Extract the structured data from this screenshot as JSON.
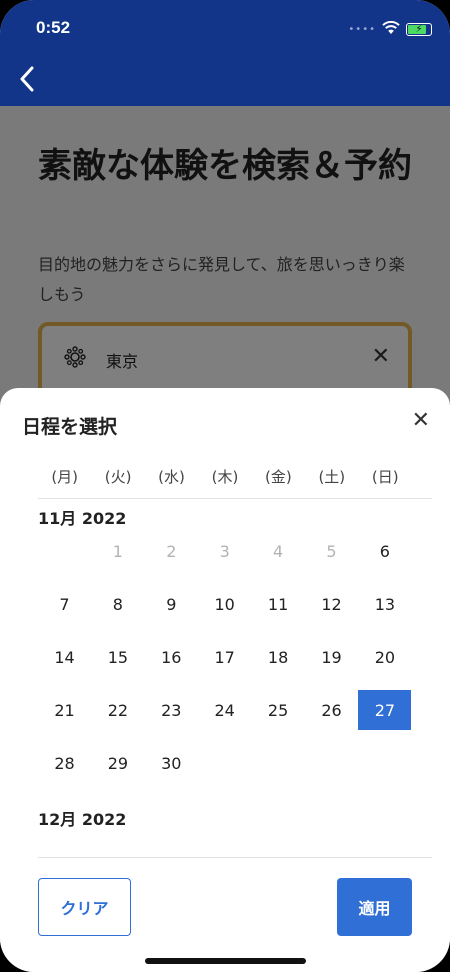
{
  "status_bar": {
    "time": "0:52"
  },
  "hero": {
    "title": "素敵な体験を検索＆予約",
    "subtitle": "目的地の魅力をさらに発見して、旅を思いっきり楽しもう"
  },
  "search": {
    "value": "東京",
    "clear_symbol": "✕"
  },
  "sheet": {
    "title": "日程を選択",
    "close_symbol": "✕",
    "weekdays": [
      "(月)",
      "(火)",
      "(水)",
      "(木)",
      "(金)",
      "(土)",
      "(日)"
    ],
    "months": [
      {
        "label": "11月 2022",
        "start_weekday_index": 1,
        "days": 30,
        "disabled_through": 5,
        "selected": 27
      },
      {
        "label": "12月 2022"
      }
    ],
    "clear_label": "クリア",
    "apply_label": "適用"
  },
  "colors": {
    "header": "#12358a",
    "accent": "#2f6fd6",
    "search_border": "#e7b24a"
  },
  "icons": {
    "back": "chevron-left-icon",
    "search_location": "landmark-icon",
    "close": "close-icon",
    "wifi": "wifi-icon",
    "battery": "battery-icon"
  }
}
